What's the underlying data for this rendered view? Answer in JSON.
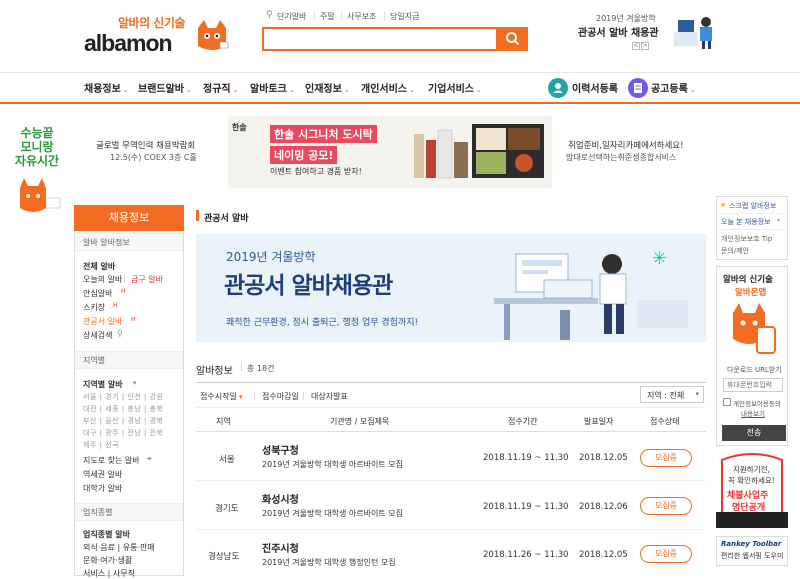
{
  "header": {
    "logo_tagline": "알바의 신기술",
    "logo_text": "albamon",
    "top_links": [
      "단기알바",
      "주말",
      "사무보조",
      "당일지급"
    ],
    "search_placeholder": "",
    "promo_subtitle": "2019년 겨울방학",
    "promo_title": "관공서 알바 채용관",
    "pager_prev": "<",
    "pager_next": ">"
  },
  "nav": {
    "items": [
      "채용정보",
      "브랜드알바",
      "정규직",
      "알바토크",
      "인재정보",
      "개인서비스",
      "기업서비스"
    ],
    "resume_label": "이력서등록",
    "post_label": "공고등록"
  },
  "banners": {
    "left_promo": [
      "수능끝",
      "모니랑",
      "자유시간"
    ],
    "exhibit_line1": "글로벌 무역인력 채용박람회",
    "exhibit_line2": "12.5(수) COEX 3층 C홀",
    "ad_brand": "한솔",
    "ad_line1": "한솔 시그니처 도시락",
    "ad_line2": "네이밍 공모!",
    "ad_line3": "이벤트 참여하고 경품 받자!",
    "right_line1": "취업준비,일자리카페에서하세요!",
    "right_line2": "맘대로선택하는취준생종합서비스"
  },
  "sidebar": {
    "title": "채용정보",
    "sec1": "알바 알바정보",
    "links1": [
      "전체 알바",
      "오늘의 알바",
      "급구 알바",
      "안심알바",
      "스키장",
      "관공서 알바",
      "상세검색"
    ],
    "sec2": "지역별",
    "region_title": "지역별 알바",
    "regions": [
      [
        "서울",
        "경기",
        "인천",
        "강원"
      ],
      [
        "대전",
        "세종",
        "충남",
        "충북"
      ],
      [
        "부산",
        "울산",
        "경남",
        "경북"
      ],
      [
        "대구",
        "광주",
        "전남",
        "전북"
      ],
      [
        "제주",
        "전국"
      ]
    ],
    "links2": [
      "지도로 찾는 알바",
      "역세권 알바",
      "대학가 알바"
    ],
    "sec3": "업직종별",
    "job_title": "업직종별 알바",
    "jobs": [
      "외식·음료 | 유통·판매",
      "문화·여가·생활",
      "서비스 | 사무직"
    ]
  },
  "main": {
    "section_title": "관공서 알바",
    "banner_sub": "2019년 겨울방학",
    "banner_title": "관공서 알바채용관",
    "banner_desc": "쾌적한 근무환경, 정시 출퇴근, 행정 업무 경험까지!",
    "list_title": "알바정보",
    "list_count": "총 18건",
    "sort": [
      "접수시작일",
      "접수마감일",
      "대상자발표"
    ],
    "region_select": "지역 : 전체",
    "columns": [
      "지역",
      "기관명 / 모집제목",
      "접수기간",
      "발표일자",
      "접수상태"
    ],
    "rows": [
      {
        "region": "서울",
        "org": "성북구청",
        "title": "2019년 겨울방학 대학생 아르바이트 모집",
        "period": "2018.11.19 ~ 11.30",
        "announce": "2018.12.05",
        "status": "모집중"
      },
      {
        "region": "경기도",
        "org": "화성시청",
        "title": "2019년 겨울방학 대학생 아르바이트 모집",
        "period": "2018.11.19 ~ 11.30",
        "announce": "2018.12.06",
        "status": "모집중"
      },
      {
        "region": "경상남도",
        "org": "진주시청",
        "title": "2019년 겨울방학 대학생 행정인턴 모집",
        "period": "2018.11.26 ~ 11.30",
        "announce": "2018.12.05",
        "status": "모집중"
      }
    ]
  },
  "right_rail": {
    "scrap": "스크랩 알바정보",
    "today": "오늘 본 채용정보",
    "tip1": "개인정보보호 Tip",
    "tip2": "문의/제안",
    "app_title": "알바의 신기술",
    "app_sub": "알바몬앱",
    "download": "다운로드 URL받기",
    "phone_placeholder": "휴대폰번호입력",
    "consent": "개인정보이용동의",
    "consent_link": "내용보기",
    "send": "전송",
    "notice1": "지원하기전,",
    "notice2": "꼭 확인하세요!",
    "notice3": "체불사업주",
    "notice4": "명단공개",
    "toolbar_brand": "Rankey Toolbar",
    "toolbar_desc": "편리한 웹서핑 도우미"
  }
}
